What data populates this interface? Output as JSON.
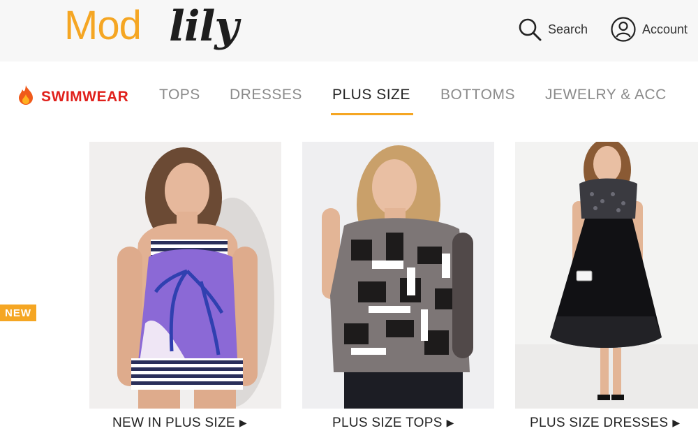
{
  "header": {
    "logo_part1": "Mod",
    "logo_part2": "lily",
    "search_label": "Search",
    "account_label": "Account"
  },
  "nav": {
    "items": [
      {
        "label": "SWIMWEAR",
        "icon": "flame-icon",
        "color": "#e0201b"
      },
      {
        "label": "TOPS"
      },
      {
        "label": "DRESSES"
      },
      {
        "label": "PLUS SIZE",
        "active": true
      },
      {
        "label": "BOTTOMS"
      },
      {
        "label": "JEWELRY & ACC"
      }
    ],
    "active_underline_color": "#f5a623"
  },
  "badge": {
    "label": "NEW",
    "color": "#f5a623"
  },
  "products": [
    {
      "caption": "NEW IN PLUS SIZE",
      "arrow": "▶",
      "image": "model in purple palm-print tankini"
    },
    {
      "caption": "PLUS SIZE TOPS",
      "arrow": "▶",
      "image": "model in geometric print top"
    },
    {
      "caption": "PLUS SIZE DRESSES",
      "arrow": "▶",
      "image": "model in black lace dress"
    }
  ],
  "colors": {
    "brand_orange": "#f5a623",
    "header_bg": "#f7f7f7",
    "hot_red": "#e0201b"
  }
}
